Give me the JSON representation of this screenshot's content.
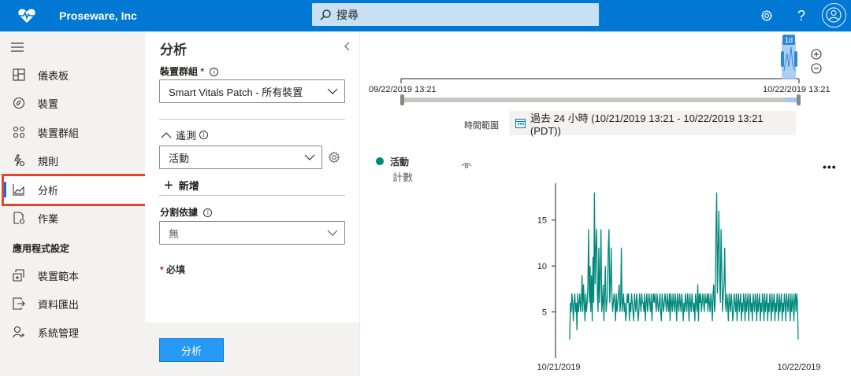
{
  "header": {
    "app_name": "Proseware, Inc",
    "search_placeholder": "搜尋",
    "help_label": "?"
  },
  "sidebar": {
    "items": [
      {
        "label": "儀表板",
        "icon": "dashboard-icon"
      },
      {
        "label": "裝置",
        "icon": "devices-icon"
      },
      {
        "label": "裝置群組",
        "icon": "device-groups-icon"
      },
      {
        "label": "規則",
        "icon": "rules-icon"
      },
      {
        "label": "分析",
        "icon": "analytics-icon",
        "active": true
      },
      {
        "label": "作業",
        "icon": "jobs-icon"
      }
    ],
    "section_title": "應用程式設定",
    "app_items": [
      {
        "label": "裝置範本",
        "icon": "device-templates-icon"
      },
      {
        "label": "資料匯出",
        "icon": "data-export-icon"
      },
      {
        "label": "系統管理",
        "icon": "administration-icon"
      }
    ]
  },
  "panel": {
    "title": "分析",
    "device_group_label": "裝置群組",
    "required_mark": "*",
    "device_group_value": "Smart Vitals Patch - 所有裝置",
    "measures_label": "遙測",
    "measure_value": "活動",
    "add_label": "新增",
    "split_by_label": "分割依據",
    "split_by_value": "無",
    "required_note": "必填",
    "analyze_button": "分析"
  },
  "timeline": {
    "start_label": "09/22/2019 13:21",
    "end_label": "10/22/2019 13:21",
    "window_badge": "1d",
    "range_label": "時間範圍",
    "range_value": "過去 24 小時 (10/21/2019 13:21 - 10/22/2019 13:21 (PDT))"
  },
  "series_legend": {
    "name": "活動",
    "aggregation": "計數",
    "color": "#00897b"
  },
  "chart_data": {
    "type": "line",
    "x_range": [
      "10/21/2019",
      "10/22/2019"
    ],
    "x_tick_labels": [
      "10/21/2019",
      "10/22/2019"
    ],
    "ylim": [
      0,
      19
    ],
    "y_ticks": [
      5,
      10,
      15
    ],
    "series": [
      {
        "name": "活動",
        "color": "#00897b",
        "values": [
          2,
          6,
          5,
          7,
          6,
          4,
          6,
          7,
          5,
          6,
          3,
          7,
          5,
          6,
          7,
          5,
          6,
          9,
          5,
          8,
          6,
          4,
          7,
          5,
          6,
          8,
          14,
          6,
          10,
          5,
          9,
          4,
          11,
          6,
          18,
          8,
          12,
          14,
          7,
          5,
          12,
          6,
          9,
          14,
          5,
          6,
          8,
          4,
          7,
          10,
          5,
          6,
          7,
          12,
          14,
          6,
          8,
          12,
          7,
          5,
          6,
          7,
          6,
          4,
          7,
          5,
          6,
          7,
          8,
          5,
          6,
          12,
          5,
          6,
          7,
          5,
          6,
          4,
          5,
          7,
          6,
          7,
          4,
          6,
          5,
          7,
          6,
          5,
          4,
          7,
          6,
          5,
          7,
          6,
          4,
          5,
          7,
          6,
          5,
          7,
          6,
          6,
          5,
          7,
          4,
          6,
          7,
          5,
          6,
          7,
          6,
          5,
          7,
          4,
          6,
          7,
          6,
          7,
          6,
          5,
          7,
          6,
          5,
          6,
          7,
          5,
          4,
          7,
          6,
          5,
          6,
          7,
          6,
          5,
          7,
          6,
          5,
          7,
          4,
          7,
          6,
          5,
          7,
          6,
          5,
          7,
          6,
          4,
          7,
          6,
          5,
          7,
          6,
          5,
          7,
          6,
          4,
          6,
          5,
          7,
          6,
          5,
          7,
          6,
          4,
          7,
          6,
          5,
          7,
          6,
          5,
          6,
          4,
          7,
          6,
          5,
          8,
          4,
          7,
          6,
          7,
          5,
          6,
          7,
          6,
          5,
          7,
          6,
          6,
          7,
          5,
          7,
          6,
          5,
          7,
          6,
          4,
          7,
          8,
          5,
          6,
          14,
          18,
          7,
          12,
          16,
          9,
          6,
          14,
          10,
          5,
          7,
          8,
          12,
          6,
          5,
          7,
          6,
          4,
          7,
          6,
          5,
          7,
          6,
          4,
          5,
          7,
          6,
          5,
          7,
          4,
          6,
          7,
          5,
          6,
          7,
          4,
          6,
          5,
          7,
          6,
          4,
          7,
          5,
          6,
          7,
          4,
          6,
          7,
          5,
          6,
          4,
          7,
          6,
          5,
          7,
          6,
          4,
          7,
          5,
          6,
          7,
          4,
          6,
          5,
          7,
          6,
          4,
          7,
          5,
          6,
          7,
          4,
          6,
          5,
          7,
          6,
          4,
          7,
          5,
          6,
          7,
          4,
          6,
          5,
          7,
          6,
          4,
          7,
          5,
          6,
          7,
          4,
          6,
          5,
          7,
          6,
          4,
          7,
          6,
          5,
          7,
          6,
          4,
          7,
          5,
          6,
          7,
          4,
          6,
          7,
          5,
          7,
          6,
          2
        ]
      }
    ]
  }
}
